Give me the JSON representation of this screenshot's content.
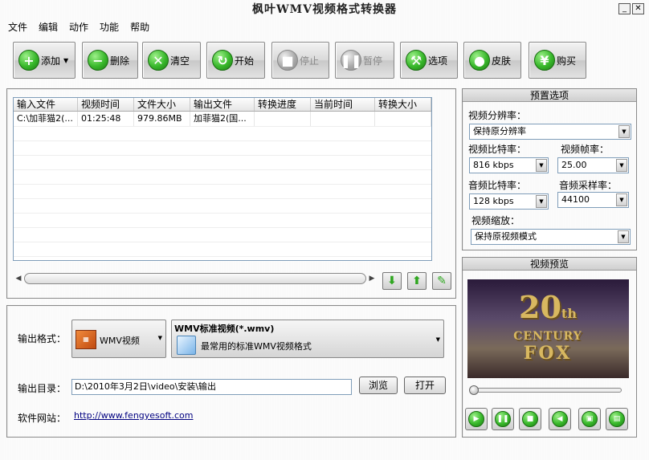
{
  "window": {
    "title": "枫叶WMV视频格式转换器",
    "min_btn": "_",
    "close_btn": "✕"
  },
  "menu": [
    "文件",
    "编辑",
    "动作",
    "功能",
    "帮助"
  ],
  "toolbar": {
    "add": "添加",
    "delete": "删除",
    "clear": "清空",
    "start": "开始",
    "stop": "停止",
    "pause": "暂停",
    "options": "选项",
    "skin": "皮肤",
    "buy": "购买"
  },
  "file_list": {
    "columns": [
      "输入文件",
      "视频时间",
      "文件大小",
      "输出文件",
      "转换进度",
      "当前时间",
      "转换大小"
    ],
    "rows": [
      [
        "C:\\加菲猫2(...",
        "01:25:48",
        "979.86MB",
        "加菲猫2(国...",
        "",
        "",
        ""
      ]
    ]
  },
  "output": {
    "format_label": "输出格式：",
    "format_btn": "WMV视频",
    "format_title": "WMV标准视频(*.wmv)",
    "format_desc": "最常用的标准WMV视频格式",
    "dir_label": "输出目录：",
    "dir_value": "D:\\2010年3月2日\\video\\安装\\输出",
    "browse": "浏览",
    "open": "打开",
    "site_label": "软件网站：",
    "site_url": "http://www.fengyesoft.com"
  },
  "presets": {
    "title": "预置选项",
    "video_res_label": "视频分辨率：",
    "video_res_value": "保持原分辨率",
    "video_bitrate_label": "视频比特率：",
    "video_bitrate_value": "816 kbps",
    "framerate_label": "视频帧率：",
    "framerate_value": "25.00",
    "audio_bitrate_label": "音频比特率：",
    "audio_bitrate_value": "128 kbps",
    "samplerate_label": "音频采样率：",
    "samplerate_value": "44100",
    "zoom_label": "视频缩放：",
    "zoom_value": "保持原视频模式"
  },
  "preview": {
    "title": "视频预览",
    "logo_number": "20",
    "logo_th": "th",
    "logo_century": "CENTURY",
    "logo_fox": "FOX"
  }
}
